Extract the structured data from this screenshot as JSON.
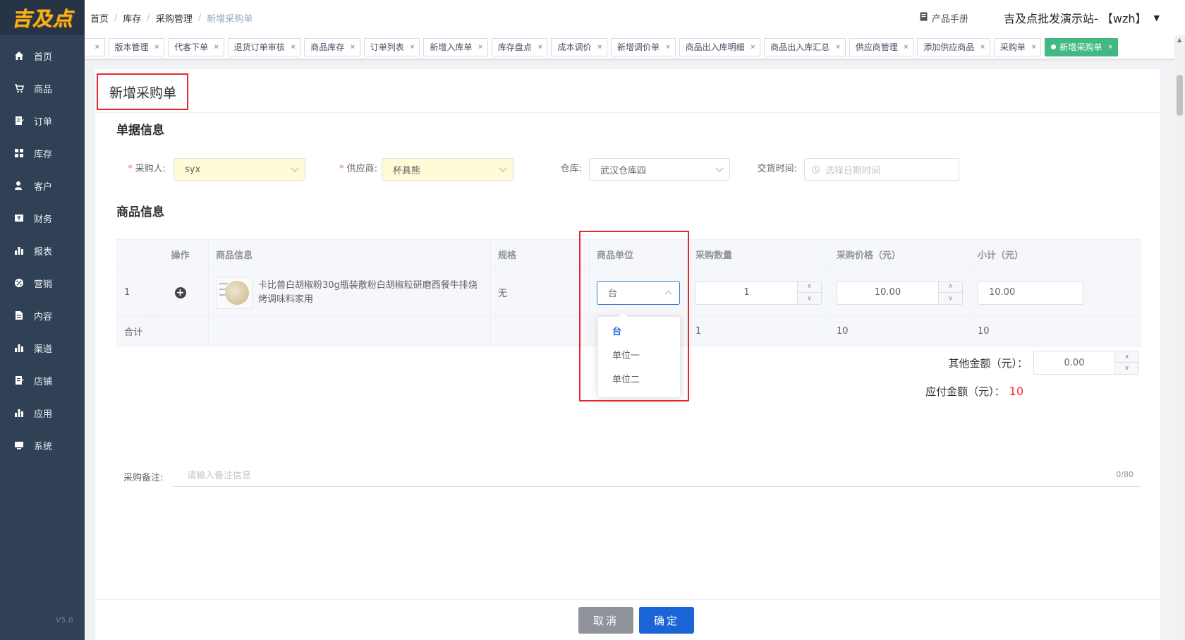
{
  "app": {
    "logo": "吉及点",
    "version": "V5.6"
  },
  "sidebar": {
    "items": [
      {
        "label": "首页",
        "icon": "home-icon"
      },
      {
        "label": "商品",
        "icon": "cart-icon"
      },
      {
        "label": "订单",
        "icon": "document-icon"
      },
      {
        "label": "库存",
        "icon": "grid-icon"
      },
      {
        "label": "客户",
        "icon": "user-icon"
      },
      {
        "label": "财务",
        "icon": "finance-icon"
      },
      {
        "label": "报表",
        "icon": "bar-chart-icon"
      },
      {
        "label": "营销",
        "icon": "percent-icon"
      },
      {
        "label": "内容",
        "icon": "document-icon"
      },
      {
        "label": "渠道",
        "icon": "bar-chart-icon"
      },
      {
        "label": "店铺",
        "icon": "document-icon"
      },
      {
        "label": "应用",
        "icon": "bar-chart-icon"
      },
      {
        "label": "系统",
        "icon": "monitor-icon"
      }
    ]
  },
  "header": {
    "breadcrumb": [
      "首页",
      "库存",
      "采购管理",
      "新增采购单"
    ],
    "manual_label": "产品手册",
    "user_label": "吉及点批发演示站- 【wzh】"
  },
  "tabs": [
    "版本管理",
    "代客下单",
    "退货订单审核",
    "商品库存",
    "订单列表",
    "新增入库单",
    "库存盘点",
    "成本调价",
    "新增调价单",
    "商品出入库明细",
    "商品出入库汇总",
    "供应商管理",
    "添加供应商品",
    "采购单"
  ],
  "active_tab": "新增采购单",
  "page": {
    "title": "新增采购单",
    "section_doc": "单据信息",
    "section_goods": "商品信息"
  },
  "form": {
    "purchaser_label": "采购人:",
    "purchaser_value": "syx",
    "supplier_label": "供应商:",
    "supplier_value": "杯具熊",
    "warehouse_label": "仓库:",
    "warehouse_value": "武汉仓库四",
    "delivery_label": "交货时间:",
    "delivery_placeholder": "选择日期时间"
  },
  "table": {
    "headers": [
      "",
      "操作",
      "商品信息",
      "规格",
      "商品单位",
      "采购数量",
      "采购价格（元）",
      "小计（元）"
    ],
    "row": {
      "index": "1",
      "product_name": "卡比兽白胡椒粉30g瓶装散粉白胡椒粒研磨西餐牛排烧烤调味料家用",
      "spec": "无",
      "unit": "台",
      "quantity": "1",
      "price": "10.00",
      "subtotal": "10.00"
    },
    "footer": {
      "label": "合计",
      "quantity": "1",
      "price": "10",
      "subtotal": "10"
    }
  },
  "unit_dropdown": {
    "options": [
      "台",
      "单位一",
      "单位二"
    ],
    "selected": "台"
  },
  "summary": {
    "other_label": "其他金额（元）：",
    "other_value": "0.00",
    "payable_label": "应付金额（元）：",
    "payable_value": "10"
  },
  "remark": {
    "label": "采购备注:",
    "placeholder": "请输入备注信息",
    "count": "0/80"
  },
  "buttons": {
    "cancel": "取消",
    "confirm": "确定"
  },
  "colors": {
    "sidebar": "#304156",
    "active_tab": "#42b983",
    "primary": "#1b64d6",
    "highlight": "#e8262a",
    "amount": "#ff2222"
  }
}
